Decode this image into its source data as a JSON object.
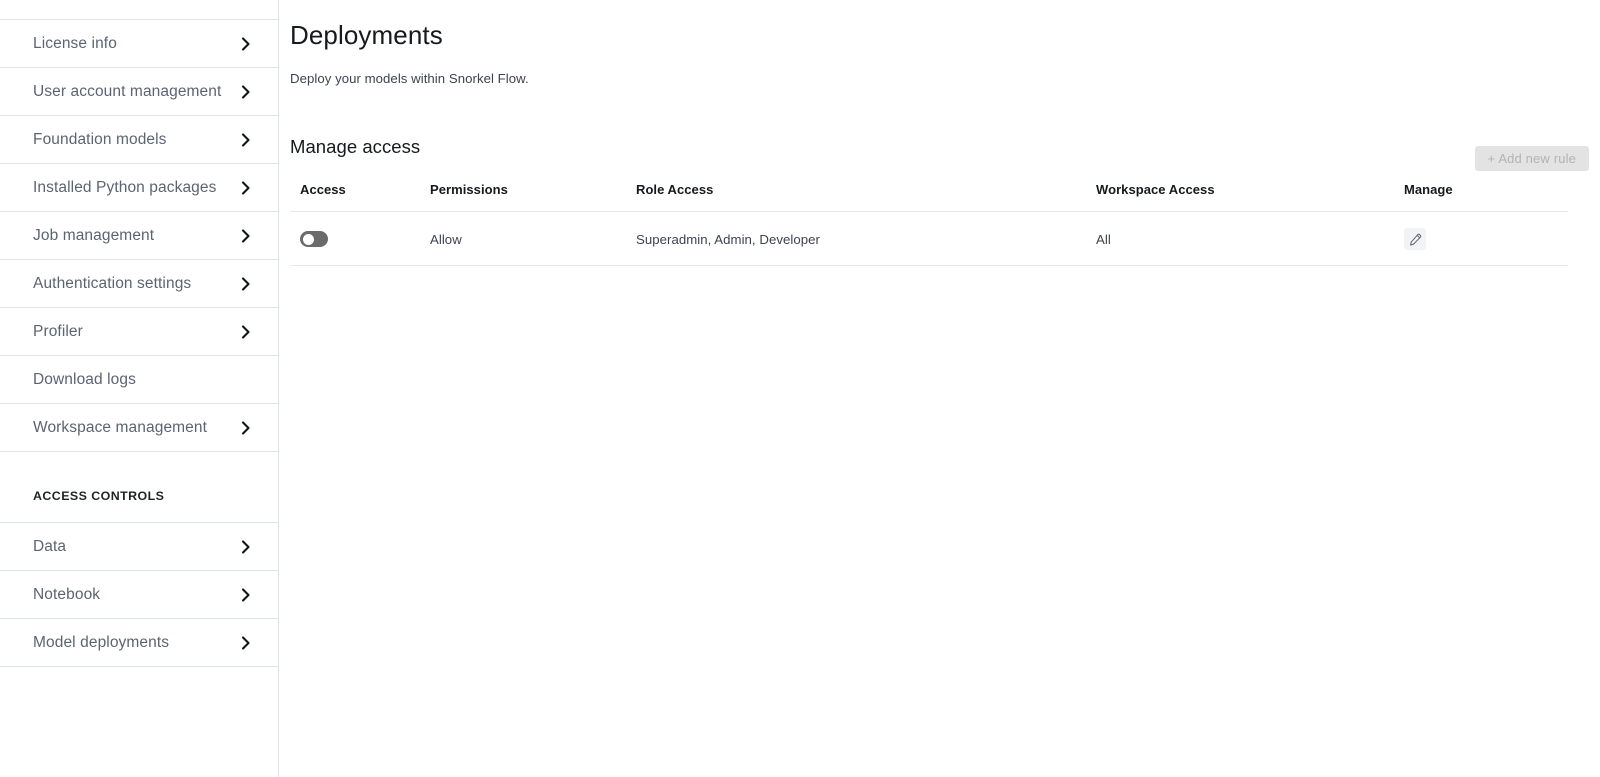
{
  "sidebar": {
    "items": [
      {
        "label": "License info",
        "has_chevron": true,
        "type": "item"
      },
      {
        "label": "User account management",
        "has_chevron": true,
        "type": "item"
      },
      {
        "label": "Foundation models",
        "has_chevron": true,
        "type": "item"
      },
      {
        "label": "Installed Python packages",
        "has_chevron": true,
        "type": "item"
      },
      {
        "label": "Job management",
        "has_chevron": true,
        "type": "item"
      },
      {
        "label": "Authentication settings",
        "has_chevron": true,
        "type": "item"
      },
      {
        "label": "Profiler",
        "has_chevron": true,
        "type": "item"
      },
      {
        "label": "Download logs",
        "has_chevron": false,
        "type": "item"
      },
      {
        "label": "Workspace management",
        "has_chevron": true,
        "type": "item"
      },
      {
        "label": "ACCESS CONTROLS",
        "has_chevron": false,
        "type": "section"
      },
      {
        "label": "Data",
        "has_chevron": true,
        "type": "item"
      },
      {
        "label": "Notebook",
        "has_chevron": true,
        "type": "item"
      },
      {
        "label": "Model deployments",
        "has_chevron": true,
        "type": "item"
      }
    ]
  },
  "main": {
    "title": "Deployments",
    "subtitle": "Deploy your models within Snorkel Flow.",
    "section_title": "Manage access",
    "add_rule_label": "+ Add new rule",
    "table": {
      "headers": [
        "Access",
        "Permissions",
        "Role Access",
        "Workspace Access",
        "Manage"
      ],
      "rows": [
        {
          "access_enabled": false,
          "permissions": "Allow",
          "role_access": "Superadmin, Admin, Developer",
          "workspace_access": "All",
          "manage_icon": "edit-pencil-icon"
        }
      ]
    }
  },
  "colors": {
    "border": "#dde3ec",
    "table_border": "#e8e8e8",
    "text_primary": "#16191d",
    "text_secondary": "#3c4350",
    "nav_text": "#5b6472",
    "toggle_off": "#6b6b6b",
    "button_disabled_bg": "#e3e3e3",
    "button_disabled_text": "#b3b3b3",
    "icon_btn_bg": "#f2f3f7"
  }
}
